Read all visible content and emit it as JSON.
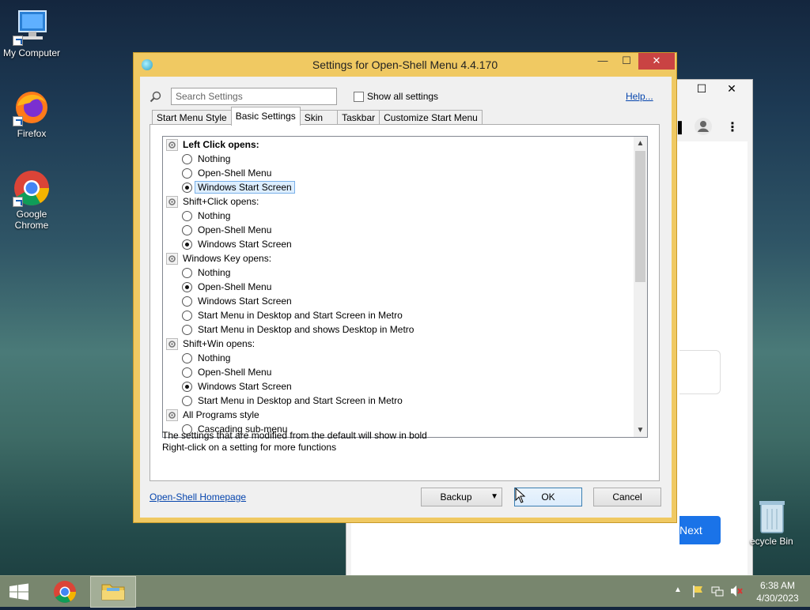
{
  "desktop": {
    "icons": [
      {
        "label": "My Computer"
      },
      {
        "label": "Firefox"
      },
      {
        "label": "Google Chrome"
      },
      {
        "label": "ecycle Bin"
      }
    ]
  },
  "background_window": {
    "next_label": "Next"
  },
  "dialog": {
    "title": "Settings for Open-Shell Menu 4.4.170",
    "minimize": "—",
    "maximize": "☐",
    "close": "✕",
    "search_placeholder": "Search Settings",
    "show_all_label": "Show all settings",
    "help_label": "Help...",
    "tabs": [
      {
        "label": "Start Menu Style"
      },
      {
        "label": "Basic Settings"
      },
      {
        "label": "Skin"
      },
      {
        "label": "Taskbar"
      },
      {
        "label": "Customize Start Menu"
      }
    ],
    "active_tab": "Basic Settings",
    "settings": {
      "groups": [
        {
          "label": "Left Click opens:",
          "bold": true,
          "options": [
            {
              "label": "Nothing",
              "checked": false
            },
            {
              "label": "Open-Shell Menu",
              "checked": false
            },
            {
              "label": "Windows Start Screen",
              "checked": true
            }
          ]
        },
        {
          "label": "Shift+Click opens:",
          "bold": false,
          "options": [
            {
              "label": "Nothing",
              "checked": false
            },
            {
              "label": "Open-Shell Menu",
              "checked": false
            },
            {
              "label": "Windows Start Screen",
              "checked": true
            }
          ]
        },
        {
          "label": "Windows Key opens:",
          "bold": false,
          "options": [
            {
              "label": "Nothing",
              "checked": false
            },
            {
              "label": "Open-Shell Menu",
              "checked": true
            },
            {
              "label": "Windows Start Screen",
              "checked": false
            },
            {
              "label": "Start Menu in Desktop and Start Screen in Metro",
              "checked": false
            },
            {
              "label": "Start Menu in Desktop and shows Desktop in Metro",
              "checked": false
            }
          ]
        },
        {
          "label": "Shift+Win opens:",
          "bold": false,
          "options": [
            {
              "label": "Nothing",
              "checked": false
            },
            {
              "label": "Open-Shell Menu",
              "checked": false
            },
            {
              "label": "Windows Start Screen",
              "checked": true
            },
            {
              "label": "Start Menu in Desktop and Start Screen in Metro",
              "checked": false
            }
          ]
        },
        {
          "label": "All Programs style",
          "bold": false,
          "options": [
            {
              "label": "Cascading sub-menu",
              "checked": false
            }
          ]
        }
      ]
    },
    "info_line1": "The settings that are modified from the default will show in bold",
    "info_line2": "Right-click on a setting for more functions",
    "homepage_link": "Open-Shell Homepage",
    "backup_label": "Backup",
    "ok_label": "OK",
    "cancel_label": "Cancel"
  },
  "taskbar": {
    "time": "6:38 AM",
    "date": "4/30/2023"
  }
}
